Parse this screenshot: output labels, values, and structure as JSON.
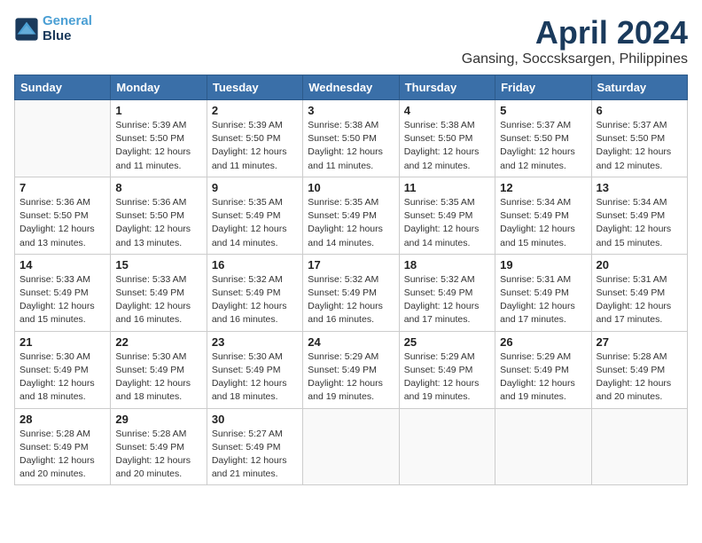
{
  "header": {
    "logo_line1": "General",
    "logo_line2": "Blue",
    "month": "April 2024",
    "location": "Gansing, Soccsksargen, Philippines"
  },
  "days_of_week": [
    "Sunday",
    "Monday",
    "Tuesday",
    "Wednesday",
    "Thursday",
    "Friday",
    "Saturday"
  ],
  "weeks": [
    [
      {
        "day": "",
        "info": ""
      },
      {
        "day": "1",
        "info": "Sunrise: 5:39 AM\nSunset: 5:50 PM\nDaylight: 12 hours\nand 11 minutes."
      },
      {
        "day": "2",
        "info": "Sunrise: 5:39 AM\nSunset: 5:50 PM\nDaylight: 12 hours\nand 11 minutes."
      },
      {
        "day": "3",
        "info": "Sunrise: 5:38 AM\nSunset: 5:50 PM\nDaylight: 12 hours\nand 11 minutes."
      },
      {
        "day": "4",
        "info": "Sunrise: 5:38 AM\nSunset: 5:50 PM\nDaylight: 12 hours\nand 12 minutes."
      },
      {
        "day": "5",
        "info": "Sunrise: 5:37 AM\nSunset: 5:50 PM\nDaylight: 12 hours\nand 12 minutes."
      },
      {
        "day": "6",
        "info": "Sunrise: 5:37 AM\nSunset: 5:50 PM\nDaylight: 12 hours\nand 12 minutes."
      }
    ],
    [
      {
        "day": "7",
        "info": "Sunrise: 5:36 AM\nSunset: 5:50 PM\nDaylight: 12 hours\nand 13 minutes."
      },
      {
        "day": "8",
        "info": "Sunrise: 5:36 AM\nSunset: 5:50 PM\nDaylight: 12 hours\nand 13 minutes."
      },
      {
        "day": "9",
        "info": "Sunrise: 5:35 AM\nSunset: 5:49 PM\nDaylight: 12 hours\nand 14 minutes."
      },
      {
        "day": "10",
        "info": "Sunrise: 5:35 AM\nSunset: 5:49 PM\nDaylight: 12 hours\nand 14 minutes."
      },
      {
        "day": "11",
        "info": "Sunrise: 5:35 AM\nSunset: 5:49 PM\nDaylight: 12 hours\nand 14 minutes."
      },
      {
        "day": "12",
        "info": "Sunrise: 5:34 AM\nSunset: 5:49 PM\nDaylight: 12 hours\nand 15 minutes."
      },
      {
        "day": "13",
        "info": "Sunrise: 5:34 AM\nSunset: 5:49 PM\nDaylight: 12 hours\nand 15 minutes."
      }
    ],
    [
      {
        "day": "14",
        "info": "Sunrise: 5:33 AM\nSunset: 5:49 PM\nDaylight: 12 hours\nand 15 minutes."
      },
      {
        "day": "15",
        "info": "Sunrise: 5:33 AM\nSunset: 5:49 PM\nDaylight: 12 hours\nand 16 minutes."
      },
      {
        "day": "16",
        "info": "Sunrise: 5:32 AM\nSunset: 5:49 PM\nDaylight: 12 hours\nand 16 minutes."
      },
      {
        "day": "17",
        "info": "Sunrise: 5:32 AM\nSunset: 5:49 PM\nDaylight: 12 hours\nand 16 minutes."
      },
      {
        "day": "18",
        "info": "Sunrise: 5:32 AM\nSunset: 5:49 PM\nDaylight: 12 hours\nand 17 minutes."
      },
      {
        "day": "19",
        "info": "Sunrise: 5:31 AM\nSunset: 5:49 PM\nDaylight: 12 hours\nand 17 minutes."
      },
      {
        "day": "20",
        "info": "Sunrise: 5:31 AM\nSunset: 5:49 PM\nDaylight: 12 hours\nand 17 minutes."
      }
    ],
    [
      {
        "day": "21",
        "info": "Sunrise: 5:30 AM\nSunset: 5:49 PM\nDaylight: 12 hours\nand 18 minutes."
      },
      {
        "day": "22",
        "info": "Sunrise: 5:30 AM\nSunset: 5:49 PM\nDaylight: 12 hours\nand 18 minutes."
      },
      {
        "day": "23",
        "info": "Sunrise: 5:30 AM\nSunset: 5:49 PM\nDaylight: 12 hours\nand 18 minutes."
      },
      {
        "day": "24",
        "info": "Sunrise: 5:29 AM\nSunset: 5:49 PM\nDaylight: 12 hours\nand 19 minutes."
      },
      {
        "day": "25",
        "info": "Sunrise: 5:29 AM\nSunset: 5:49 PM\nDaylight: 12 hours\nand 19 minutes."
      },
      {
        "day": "26",
        "info": "Sunrise: 5:29 AM\nSunset: 5:49 PM\nDaylight: 12 hours\nand 19 minutes."
      },
      {
        "day": "27",
        "info": "Sunrise: 5:28 AM\nSunset: 5:49 PM\nDaylight: 12 hours\nand 20 minutes."
      }
    ],
    [
      {
        "day": "28",
        "info": "Sunrise: 5:28 AM\nSunset: 5:49 PM\nDaylight: 12 hours\nand 20 minutes."
      },
      {
        "day": "29",
        "info": "Sunrise: 5:28 AM\nSunset: 5:49 PM\nDaylight: 12 hours\nand 20 minutes."
      },
      {
        "day": "30",
        "info": "Sunrise: 5:27 AM\nSunset: 5:49 PM\nDaylight: 12 hours\nand 21 minutes."
      },
      {
        "day": "",
        "info": ""
      },
      {
        "day": "",
        "info": ""
      },
      {
        "day": "",
        "info": ""
      },
      {
        "day": "",
        "info": ""
      }
    ]
  ]
}
